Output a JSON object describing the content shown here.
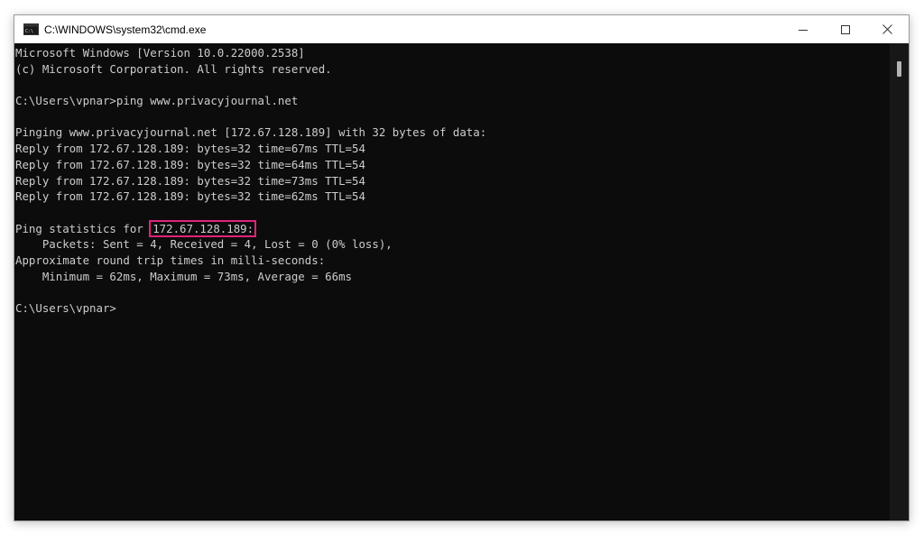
{
  "window": {
    "title": "C:\\WINDOWS\\system32\\cmd.exe"
  },
  "console": {
    "lines": [
      "Microsoft Windows [Version 10.0.22000.2538]",
      "(c) Microsoft Corporation. All rights reserved.",
      "",
      "C:\\Users\\vpnar>ping www.privacyjournal.net",
      "",
      "Pinging www.privacyjournal.net [172.67.128.189] with 32 bytes of data:",
      "Reply from 172.67.128.189: bytes=32 time=67ms TTL=54",
      "Reply from 172.67.128.189: bytes=32 time=64ms TTL=54",
      "Reply from 172.67.128.189: bytes=32 time=73ms TTL=54",
      "Reply from 172.67.128.189: bytes=32 time=62ms TTL=54",
      "",
      "Ping statistics for ",
      "    Packets: Sent = 4, Received = 4, Lost = 0 (0% loss),",
      "Approximate round trip times in milli-seconds:",
      "    Minimum = 62ms, Maximum = 73ms, Average = 66ms",
      "",
      "C:\\Users\\vpnar>"
    ],
    "highlighted_ip": "172.67.128.189:"
  },
  "colors": {
    "console_background": "#0c0c0c",
    "console_text": "#cccccc",
    "highlight_border": "#e0237a",
    "titlebar_background": "#ffffff"
  },
  "icons": {
    "app": "cmd-app-icon",
    "minimize": "minimize-icon",
    "maximize": "maximize-icon",
    "close": "close-icon"
  }
}
